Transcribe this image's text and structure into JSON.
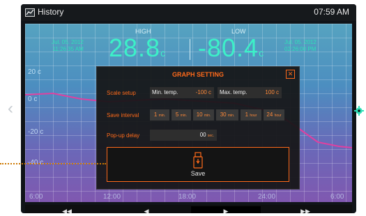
{
  "titlebar": {
    "title": "History",
    "clock": "07:59 AM",
    "icon": "history-icon"
  },
  "readout": {
    "high": {
      "label": "HIGH",
      "value": "28.8",
      "unit": "c",
      "date": "Jul. 05. 2012",
      "time": "11:26:35 AM"
    },
    "low": {
      "label": "LOW",
      "value": "-80.4",
      "unit": "c",
      "date": "Jul. 05. 2012",
      "time": "02:26:00 PM"
    }
  },
  "axis": {
    "y_labels": [
      "20 c",
      "0 c",
      "-20 c",
      "-40 c"
    ],
    "x_labels": [
      "6:00",
      "12:00",
      "18:00",
      "24:00",
      "6:00"
    ]
  },
  "dialog": {
    "title": "GRAPH SETTING",
    "close_icon": "close-icon",
    "scale_setup": {
      "label": "Scale setup",
      "min_label": "Min. temp.",
      "min_value": "-100 c",
      "max_label": "Max. temp.",
      "max_value": "100 c"
    },
    "save_interval": {
      "label": "Save interval",
      "options": [
        {
          "num": "1",
          "unit": "min."
        },
        {
          "num": "5",
          "unit": "min."
        },
        {
          "num": "10",
          "unit": "min."
        },
        {
          "num": "30",
          "unit": "min."
        },
        {
          "num": "1",
          "unit": "hour"
        },
        {
          "num": "24",
          "unit": "hour"
        }
      ]
    },
    "popup_delay": {
      "label": "Pop-up delay",
      "value": "00",
      "unit": "sec."
    },
    "save": {
      "label": "Save",
      "icon": "usb-drive-icon"
    }
  },
  "controls": {
    "rewind": "◀◀",
    "prev": "◀",
    "play": "▶",
    "forward": "▶▶"
  },
  "colors": {
    "accent": "#ff6a1a",
    "readout": "#3df0c8",
    "trend_line": "#e040a0"
  }
}
